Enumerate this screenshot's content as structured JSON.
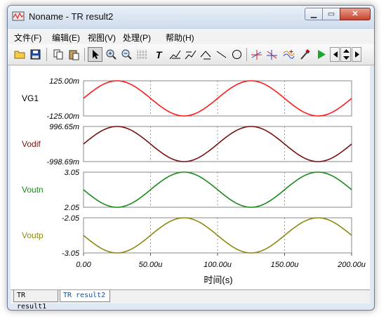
{
  "window": {
    "title": "Noname - TR result2"
  },
  "menu": [
    "文件(F)",
    "编辑(E)",
    "视图(V)",
    "处理(P)",
    "帮助(H)"
  ],
  "toolbar": [
    "open-folder",
    "save",
    "copy",
    "paste",
    "pointer",
    "zoom-in",
    "zoom-out",
    "grid",
    "text",
    "cursor-tool-a",
    "cursor-tool-b",
    "cursor-tool-c",
    "line",
    "circle",
    "marker-a",
    "marker-b",
    "wave",
    "probe",
    "run",
    "nav-left",
    "nav-updown",
    "nav-right"
  ],
  "chart_data": {
    "type": "line",
    "xlabel": "时间(s)",
    "x_ticks": [
      "0.00",
      "50.00u",
      "100.00u",
      "150.00u",
      "200.00u"
    ],
    "x_range_us": [
      0,
      200
    ],
    "period_us": 100,
    "panels": [
      {
        "name": "VG1",
        "top": "125.00m",
        "bottom": "-125.00m",
        "color": "#ff1a1a",
        "amplitude": 0.125,
        "offset": 0,
        "phase_peak_us": 25
      },
      {
        "name": "Vodif",
        "top": "996.65m",
        "bottom": "-998.69m",
        "color": "#7a1010",
        "amplitude": 1.0,
        "offset": 0,
        "phase_peak_us": 25
      },
      {
        "name": "Voutn",
        "top": "3.05",
        "bottom": "2.05",
        "color": "#1a8a1a",
        "amplitude": 0.5,
        "offset": 2.55,
        "phase_peak_us": 75
      },
      {
        "name": "Voutp",
        "top": "-2.05",
        "bottom": "-3.05",
        "color": "#8a8a10",
        "amplitude": 0.5,
        "offset": -2.55,
        "phase_peak_us": 75
      }
    ]
  },
  "tabs": [
    "TR result1",
    "TR result2"
  ]
}
